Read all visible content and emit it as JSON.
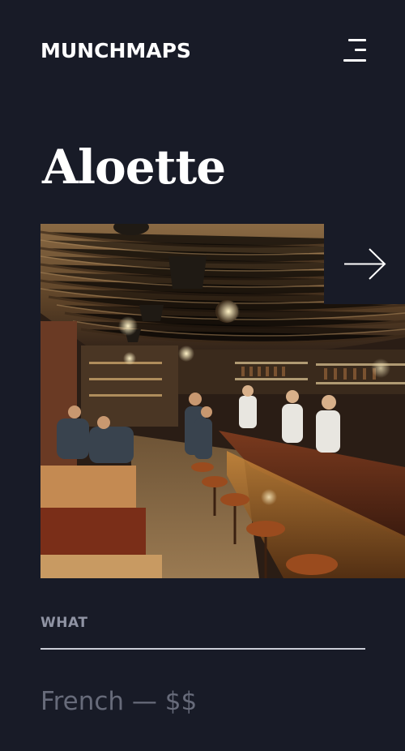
{
  "header": {
    "logo_text": "MUNCHMAPS",
    "menu_icon": "hamburger-menu-icon"
  },
  "restaurant": {
    "name": "Aloette",
    "photo_icon": "restaurant-interior-photo",
    "next_icon": "arrow-right-icon"
  },
  "what": {
    "label": "WHAT",
    "value": "French — $$"
  },
  "colors": {
    "background": "#181b27",
    "text_primary": "#ffffff",
    "label_muted": "#8f93a3",
    "value_muted": "#676b7a",
    "divider": "#c9ccd6"
  }
}
